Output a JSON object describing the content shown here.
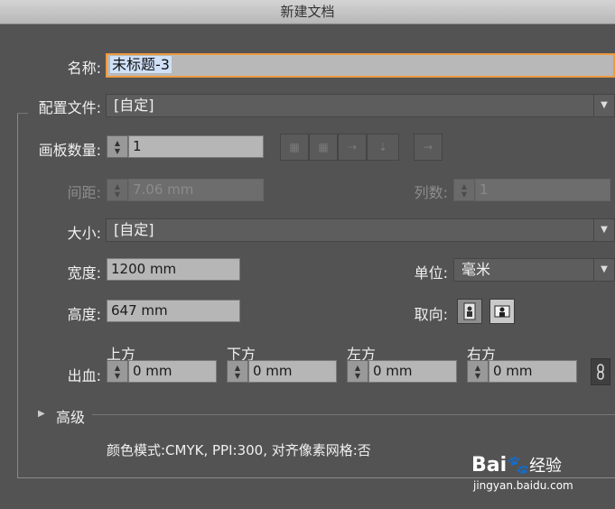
{
  "window": {
    "title": "新建文档"
  },
  "name_row": {
    "label": "名称:",
    "value": "未标题-3"
  },
  "profile": {
    "label": "配置文件:",
    "value": "[自定]"
  },
  "artboards": {
    "label": "画板数量:",
    "value": "1"
  },
  "spacing": {
    "label": "间距:",
    "value": "7.06 mm"
  },
  "columns": {
    "label": "列数:",
    "value": "1"
  },
  "size": {
    "label": "大小:",
    "value": "[自定]"
  },
  "width": {
    "label": "宽度:",
    "value": "1200 mm"
  },
  "height": {
    "label": "高度:",
    "value": "647 mm"
  },
  "units": {
    "label": "单位:",
    "value": "毫米"
  },
  "orientation": {
    "label": "取向:"
  },
  "bleed": {
    "label": "出血:",
    "top": {
      "label": "上方",
      "value": "0 mm"
    },
    "bottom": {
      "label": "下方",
      "value": "0 mm"
    },
    "left": {
      "label": "左方",
      "value": "0 mm"
    },
    "right": {
      "label": "右方",
      "value": "0 mm"
    }
  },
  "advanced": {
    "label": "高级"
  },
  "summary": "颜色模式:CMYK, PPI:300, 对齐像素网格:否",
  "watermark": {
    "brand": "Bai",
    "brand2": "经验",
    "url": "jingyan.baidu.com"
  },
  "colors": {
    "background": "#535353",
    "focus": "#ee9a3e",
    "field": "#b6b6b6"
  }
}
